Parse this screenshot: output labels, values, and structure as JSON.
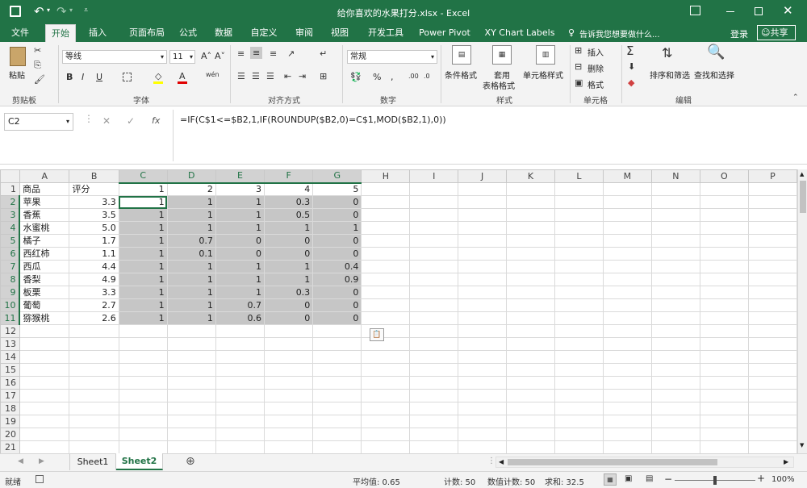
{
  "window": {
    "title": "给你喜欢的水果打分.xlsx - Excel",
    "login": "登录",
    "share": "共享",
    "tell_me": "告诉我您想要做什么..."
  },
  "tabs": [
    "文件",
    "开始",
    "插入",
    "页面布局",
    "公式",
    "数据",
    "自定义",
    "审阅",
    "视图",
    "开发工具",
    "Power Pivot",
    "XY Chart Labels"
  ],
  "ribbon": {
    "clipboard": {
      "paste": "粘贴",
      "label": "剪贴板"
    },
    "font": {
      "name": "等线",
      "size": "11",
      "label": "字体",
      "bold": "B",
      "italic": "I",
      "underline": "U",
      "grow": "A˄",
      "shrink": "A˅",
      "font_color": "A",
      "wen": "wén"
    },
    "alignment": {
      "label": "对齐方式"
    },
    "number": {
      "format": "常规",
      "label": "数字",
      "pct": "%"
    },
    "styles": {
      "cond": "条件格式",
      "table1": "套用",
      "table2": "表格格式",
      "cell": "单元格样式",
      "label": "样式"
    },
    "cells": {
      "insert": "插入",
      "delete": "删除",
      "format": "格式",
      "label": "单元格"
    },
    "editing": {
      "sort": "排序和筛选",
      "find": "查找和选择",
      "label": "编辑"
    }
  },
  "formula_bar": {
    "name_box": "C2",
    "cancel": "✕",
    "enter": "✓",
    "fx": "fx",
    "formula": "=IF(C$1<=$B2,1,IF(ROUNDUP($B2,0)=C$1,MOD($B2,1),0))"
  },
  "grid": {
    "columns": [
      "A",
      "B",
      "C",
      "D",
      "E",
      "F",
      "G",
      "H",
      "I",
      "J",
      "K",
      "L",
      "M",
      "N",
      "O",
      "P"
    ],
    "rows": [
      [
        "商品",
        "评分",
        "1",
        "2",
        "3",
        "4",
        "5"
      ],
      [
        "苹果",
        "3.3",
        "1",
        "1",
        "1",
        "0.3",
        "0"
      ],
      [
        "香蕉",
        "3.5",
        "1",
        "1",
        "1",
        "0.5",
        "0"
      ],
      [
        "水蜜桃",
        "5.0",
        "1",
        "1",
        "1",
        "1",
        "1"
      ],
      [
        "橘子",
        "1.7",
        "1",
        "0.7",
        "0",
        "0",
        "0"
      ],
      [
        "西红柿",
        "1.1",
        "1",
        "0.1",
        "0",
        "0",
        "0"
      ],
      [
        "西瓜",
        "4.4",
        "1",
        "1",
        "1",
        "1",
        "0.4"
      ],
      [
        "香梨",
        "4.9",
        "1",
        "1",
        "1",
        "1",
        "0.9"
      ],
      [
        "板栗",
        "3.3",
        "1",
        "1",
        "1",
        "0.3",
        "0"
      ],
      [
        "葡萄",
        "2.7",
        "1",
        "1",
        "0.7",
        "0",
        "0"
      ],
      [
        "猕猴桃",
        "2.6",
        "1",
        "1",
        "0.6",
        "0",
        "0"
      ]
    ],
    "total_rows": 21
  },
  "sheets": {
    "tabs": [
      "Sheet1",
      "Sheet2"
    ],
    "active": 1,
    "add": "⊕"
  },
  "status": {
    "ready": "就绪",
    "average": "平均值: 0.65",
    "count": "计数: 50",
    "numeric_count": "数值计数: 50",
    "sum": "求和: 32.5",
    "zoom": "100%"
  },
  "colors": {
    "accent": "#217346",
    "selection": "#c6c6c6"
  }
}
